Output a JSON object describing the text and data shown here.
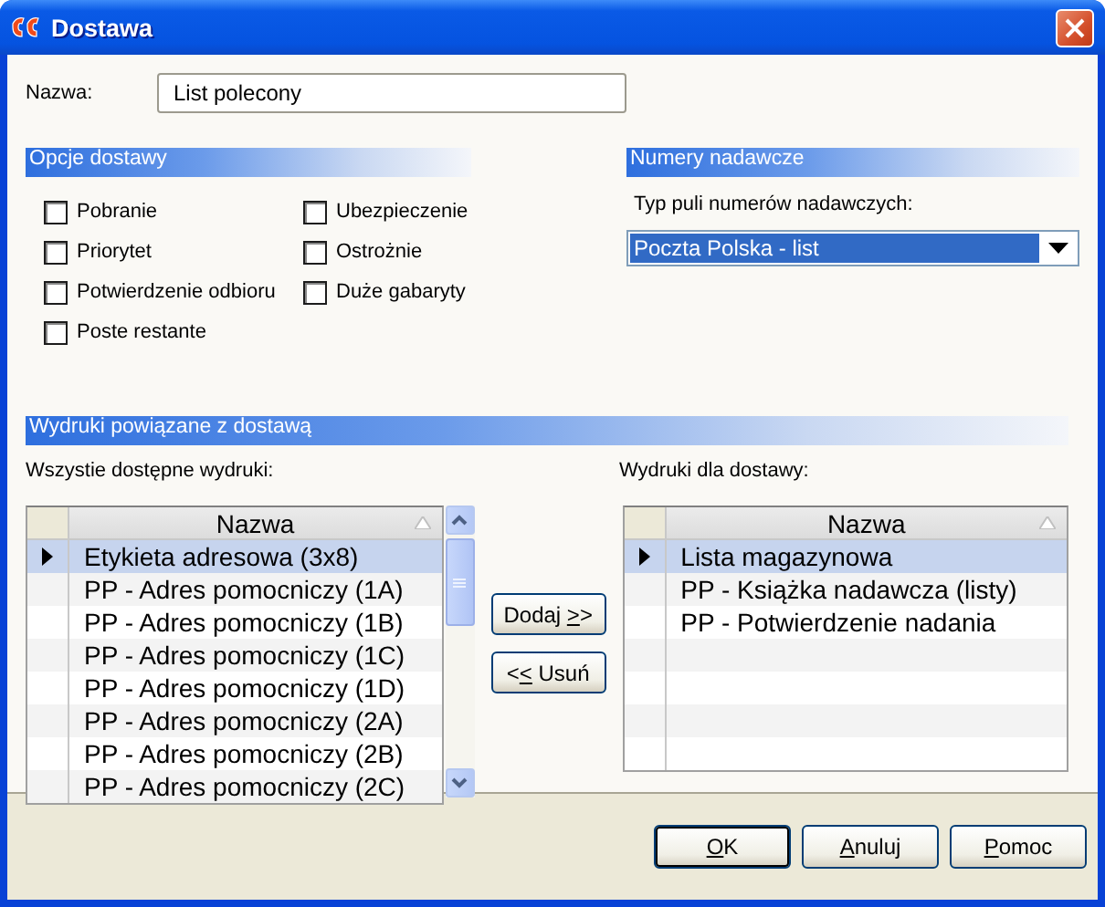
{
  "window": {
    "title": "Dostawa"
  },
  "name_field": {
    "label": "Nazwa:",
    "value": "List polecony"
  },
  "delivery_options": {
    "title": "Opcje dostawy",
    "options": [
      {
        "label": "Pobranie",
        "checked": false
      },
      {
        "label": "Priorytet",
        "checked": false
      },
      {
        "label": "Potwierdzenie odbioru",
        "checked": false
      },
      {
        "label": "Poste restante",
        "checked": false
      },
      {
        "label": "Ubezpieczenie",
        "checked": false
      },
      {
        "label": "Ostrożnie",
        "checked": false
      },
      {
        "label": "Duże gabaryty",
        "checked": false
      }
    ]
  },
  "sender_numbers": {
    "title": "Numery nadawcze",
    "pool_label": "Typ puli numerów nadawczych:",
    "pool_value": "Poczta Polska - list"
  },
  "printouts": {
    "title": "Wydruki powiązane z dostawą",
    "available": {
      "label": "Wszystie dostępne wydruki:",
      "column": "Nazwa",
      "rows": [
        {
          "name": "Etykieta adresowa (3x8)",
          "selected": true
        },
        {
          "name": "PP - Adres pomocniczy (1A)",
          "selected": false
        },
        {
          "name": "PP - Adres pomocniczy (1B)",
          "selected": false
        },
        {
          "name": "PP - Adres pomocniczy (1C)",
          "selected": false
        },
        {
          "name": "PP - Adres pomocniczy (1D)",
          "selected": false
        },
        {
          "name": "PP - Adres pomocniczy (2A)",
          "selected": false
        },
        {
          "name": "PP - Adres pomocniczy (2B)",
          "selected": false
        },
        {
          "name": "PP - Adres pomocniczy (2C)",
          "selected": false
        }
      ]
    },
    "add_button": {
      "label_before": "Dodaj ",
      "access_key": ">",
      "label_after": ">"
    },
    "remove_button": {
      "label_before": "<",
      "access_key": "<",
      "label_after": " Usuń"
    },
    "assigned": {
      "label": "Wydruki dla dostawy:",
      "column": "Nazwa",
      "rows": [
        {
          "name": "Lista magazynowa",
          "selected": true
        },
        {
          "name": "PP - Książka nadawcza (listy)",
          "selected": false
        },
        {
          "name": "PP - Potwierdzenie nadania",
          "selected": false
        }
      ]
    }
  },
  "buttons": [
    {
      "access_key": "O",
      "label_after": "K",
      "default": true
    },
    {
      "access_key": "A",
      "label_after": "nuluj",
      "default": false
    },
    {
      "access_key": "P",
      "label_after": "omoc",
      "default": false
    }
  ]
}
